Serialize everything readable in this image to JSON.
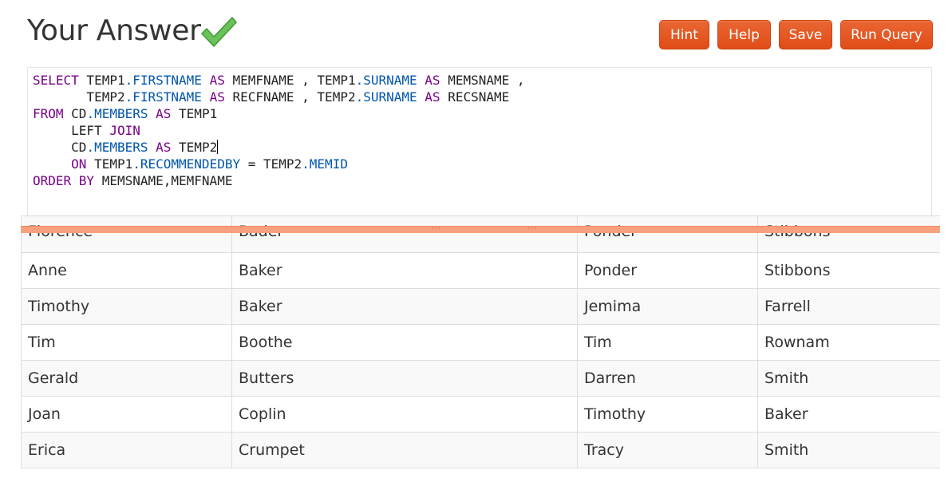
{
  "header": {
    "title": "Your Answer",
    "status_icon": "checkmark-icon",
    "status_color": "#5cb85c"
  },
  "toolbar": {
    "hint_label": "Hint",
    "help_label": "Help",
    "save_label": "Save",
    "run_label": "Run Query",
    "button_color": "#e5531f"
  },
  "editor": {
    "lines": [
      [
        {
          "t": "SELECT",
          "c": "kw"
        },
        {
          "t": " TEMP1",
          "c": ""
        },
        {
          "t": ".FIRSTNAME",
          "c": "fld"
        },
        {
          "t": " ",
          "c": ""
        },
        {
          "t": "AS",
          "c": "kw"
        },
        {
          "t": " MEMFNAME , TEMP1",
          "c": ""
        },
        {
          "t": ".SURNAME",
          "c": "fld"
        },
        {
          "t": " ",
          "c": ""
        },
        {
          "t": "AS",
          "c": "kw"
        },
        {
          "t": " MEMSNAME ,",
          "c": ""
        }
      ],
      [
        {
          "t": "       TEMP2",
          "c": ""
        },
        {
          "t": ".FIRSTNAME",
          "c": "fld"
        },
        {
          "t": " ",
          "c": ""
        },
        {
          "t": "AS",
          "c": "kw"
        },
        {
          "t": " RECFNAME , TEMP2",
          "c": ""
        },
        {
          "t": ".SURNAME",
          "c": "fld"
        },
        {
          "t": " ",
          "c": ""
        },
        {
          "t": "AS",
          "c": "kw"
        },
        {
          "t": " RECSNAME",
          "c": ""
        }
      ],
      [
        {
          "t": "FROM",
          "c": "kw"
        },
        {
          "t": " CD",
          "c": ""
        },
        {
          "t": ".MEMBERS",
          "c": "fld"
        },
        {
          "t": " ",
          "c": ""
        },
        {
          "t": "AS",
          "c": "kw"
        },
        {
          "t": " TEMP1",
          "c": ""
        }
      ],
      [
        {
          "t": "     LEFT ",
          "c": ""
        },
        {
          "t": "JOIN",
          "c": "kw"
        }
      ],
      [
        {
          "t": "     CD",
          "c": ""
        },
        {
          "t": ".MEMBERS",
          "c": "fld"
        },
        {
          "t": " ",
          "c": ""
        },
        {
          "t": "AS",
          "c": "kw"
        },
        {
          "t": " TEMP2",
          "c": ""
        }
      ],
      [
        {
          "t": "     ",
          "c": ""
        },
        {
          "t": "ON",
          "c": "kw"
        },
        {
          "t": " TEMP1",
          "c": ""
        },
        {
          "t": ".RECOMMENDEDBY",
          "c": "fld"
        },
        {
          "t": " = TEMP2",
          "c": ""
        },
        {
          "t": ".MEMID",
          "c": "fld"
        }
      ],
      [
        {
          "t": "ORDER BY",
          "c": "kw"
        },
        {
          "t": " MEMSNAME,MEMFNAME",
          "c": ""
        }
      ]
    ]
  },
  "results": {
    "rows": [
      [
        "Florence",
        "Bader",
        "Ponder",
        "Stibbons"
      ],
      [
        "Anne",
        "Baker",
        "Ponder",
        "Stibbons"
      ],
      [
        "Timothy",
        "Baker",
        "Jemima",
        "Farrell"
      ],
      [
        "Tim",
        "Boothe",
        "Tim",
        "Rownam"
      ],
      [
        "Gerald",
        "Butters",
        "Darren",
        "Smith"
      ],
      [
        "Joan",
        "Coplin",
        "Timothy",
        "Baker"
      ],
      [
        "Erica",
        "Crumpet",
        "Tracy",
        "Smith"
      ]
    ]
  }
}
